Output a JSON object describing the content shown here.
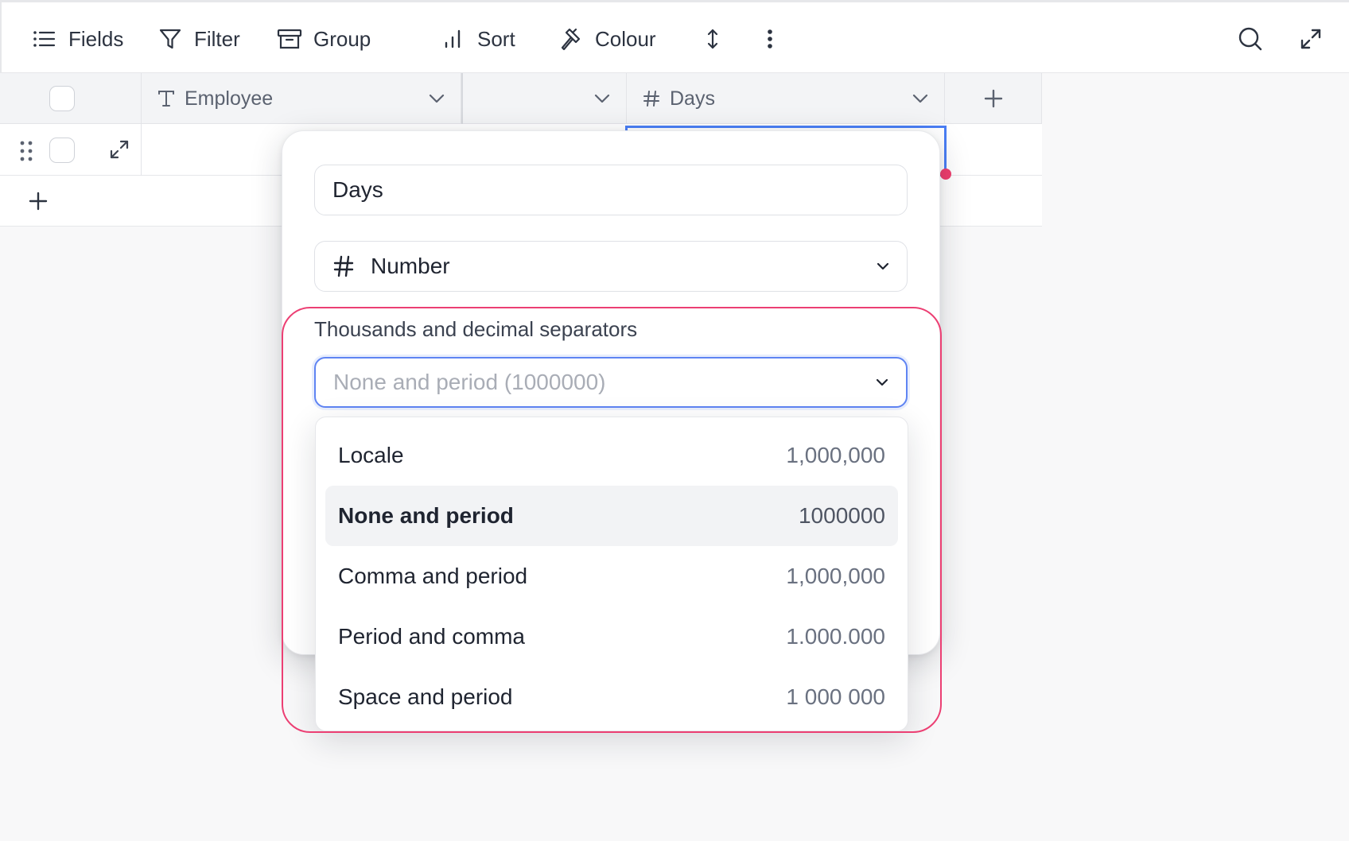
{
  "toolbar": {
    "fields_label": "Fields",
    "filter_label": "Filter",
    "group_label": "Group",
    "sort_label": "Sort",
    "colour_label": "Colour"
  },
  "table": {
    "columns": [
      {
        "name": "Employee",
        "type_icon": "text-type-icon"
      },
      {
        "name": "",
        "type_icon": ""
      },
      {
        "name": "Days",
        "type_icon": "hash-icon"
      }
    ]
  },
  "field_editor": {
    "name_value": "Days",
    "type_value": "Number",
    "separator_label": "Thousands and decimal separators",
    "separator_placeholder": "None and period (1000000)",
    "options": [
      {
        "label": "Locale",
        "example": "1,000,000"
      },
      {
        "label": "None and period",
        "example": "1000000",
        "active": true
      },
      {
        "label": "Comma and period",
        "example": "1,000,000"
      },
      {
        "label": "Period and comma",
        "example": "1.000.000"
      },
      {
        "label": "Space and period",
        "example": "1 000 000"
      }
    ]
  },
  "colors": {
    "accent": "#5f84f3",
    "highlight": "#ec3f73",
    "selected_cell": "#4a7ef5"
  }
}
